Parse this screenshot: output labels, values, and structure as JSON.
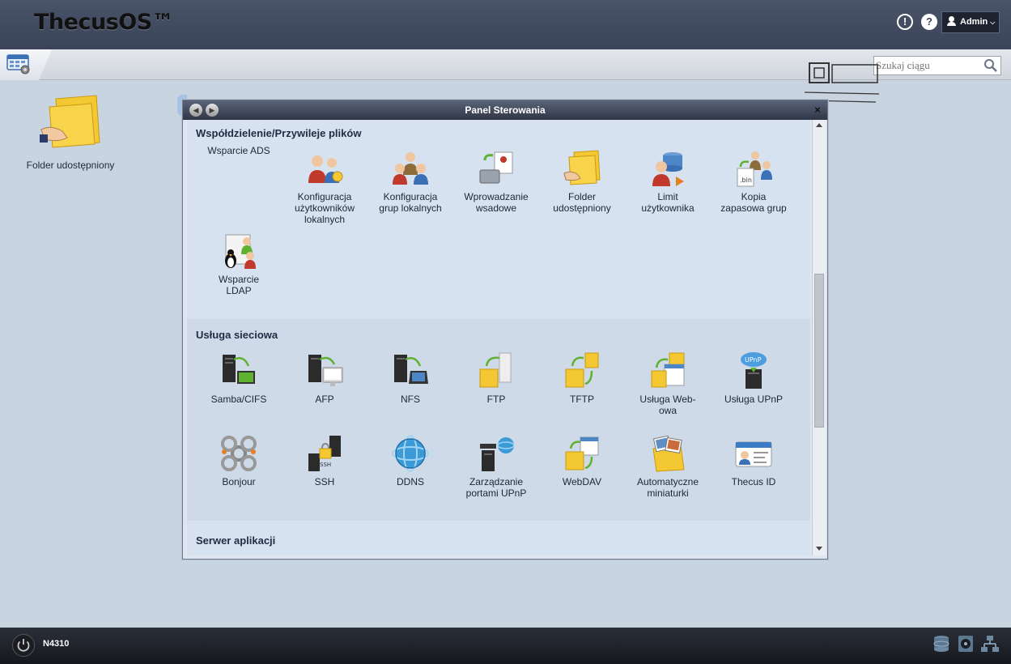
{
  "header": {
    "brand": "ThecusOS™",
    "user_label": "Admin"
  },
  "toolbar": {
    "search_placeholder": "Szukaj ciągu"
  },
  "desktop": {
    "icons": [
      {
        "label": "Folder udostępniony",
        "icon": "shared-folder-icon"
      }
    ]
  },
  "window": {
    "title": "Panel Sterowania",
    "sections": [
      {
        "title": "Współdzielenie/Przywileje plików",
        "items": [
          {
            "label": "Wsparcie ADS",
            "icon": "ads-icon"
          },
          {
            "label": "Konfiguracja użytkowników lokalnych",
            "icon": "local-users-icon"
          },
          {
            "label": "Konfiguracja grup lokalnych",
            "icon": "local-groups-icon"
          },
          {
            "label": "Wprowadzanie wsadowe",
            "icon": "batch-input-icon"
          },
          {
            "label": "Folder udostępniony",
            "icon": "shared-folder-icon"
          },
          {
            "label": "Limit użytkownika",
            "icon": "user-quota-icon"
          },
          {
            "label": "Kopia zapasowa grup",
            "icon": "group-backup-icon"
          },
          {
            "label": "Wsparcie LDAP",
            "icon": "ldap-icon"
          }
        ]
      },
      {
        "title": "Usługa sieciowa",
        "items": [
          {
            "label": "Samba/CIFS",
            "icon": "samba-icon"
          },
          {
            "label": "AFP",
            "icon": "afp-icon"
          },
          {
            "label": "NFS",
            "icon": "nfs-icon"
          },
          {
            "label": "FTP",
            "icon": "ftp-icon"
          },
          {
            "label": "TFTP",
            "icon": "tftp-icon"
          },
          {
            "label": "Usługa Web-owa",
            "icon": "web-service-icon"
          },
          {
            "label": "Usługa UPnP",
            "icon": "upnp-icon"
          },
          {
            "label": "Bonjour",
            "icon": "bonjour-icon"
          },
          {
            "label": "SSH",
            "icon": "ssh-icon"
          },
          {
            "label": "DDNS",
            "icon": "ddns-icon"
          },
          {
            "label": "Zarządzanie portami UPnP",
            "icon": "upnp-port-icon"
          },
          {
            "label": "WebDAV",
            "icon": "webdav-icon"
          },
          {
            "label": "Automatyczne miniaturki",
            "icon": "thumbnail-icon"
          },
          {
            "label": "Thecus ID",
            "icon": "thecus-id-icon"
          }
        ]
      },
      {
        "title": "Serwer aplikacji",
        "items": []
      }
    ]
  },
  "bottom": {
    "device": "N4310"
  },
  "colors": {
    "header_bg": "#3f475a",
    "desktop_bg": "#c9d4e1",
    "window_bg": "#d7e2f1",
    "folder_yellow": "#f0c12b"
  }
}
